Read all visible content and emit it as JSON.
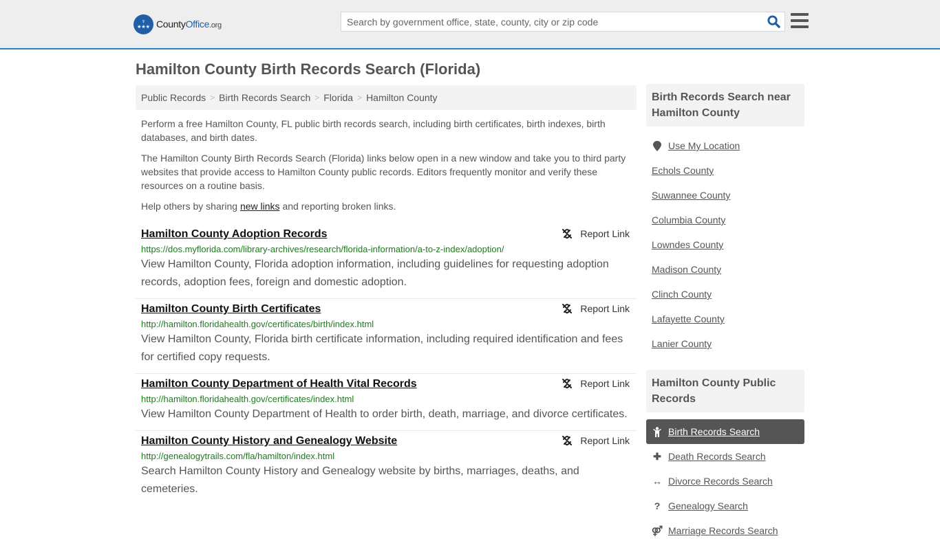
{
  "header": {
    "logo": {
      "part1": "County",
      "part2": "Office",
      "part3": ".org"
    },
    "search_placeholder": "Search by government office, state, county, city or zip code",
    "search_value": "",
    "accent_color": "#337ab7"
  },
  "page_title": "Hamilton County Birth Records Search (Florida)",
  "breadcrumb": [
    {
      "label": "Public Records"
    },
    {
      "label": "Birth Records Search"
    },
    {
      "label": "Florida"
    },
    {
      "label": "Hamilton County"
    }
  ],
  "intro": {
    "p1": "Perform a free Hamilton County, FL public birth records search, including birth certificates, birth indexes, birth databases, and birth dates.",
    "p2": "The Hamilton County Birth Records Search (Florida) links below open in a new window and take you to third party websites that provide access to Hamilton County public records. Editors frequently monitor and verify these resources on a routine basis.",
    "p3_before": "Help others by sharing ",
    "p3_link": "new links",
    "p3_after": " and reporting broken links."
  },
  "report_label": "Report Link",
  "results": [
    {
      "title": "Hamilton County Adoption Records",
      "url": "https://dos.myflorida.com/library-archives/research/florida-information/a-to-z-index/adoption/",
      "desc": "View Hamilton County, Florida adoption information, including guidelines for requesting adoption records, adoption fees, foreign and domestic adoption."
    },
    {
      "title": "Hamilton County Birth Certificates",
      "url": "http://hamilton.floridahealth.gov/certificates/birth/index.html",
      "desc": "View Hamilton County, Florida birth certificate information, including required identification and fees for certified copy requests."
    },
    {
      "title": "Hamilton County Department of Health Vital Records",
      "url": "http://hamilton.floridahealth.gov/certificates/index.html",
      "desc": "View Hamilton County Department of Health to order birth, death, marriage, and divorce certificates."
    },
    {
      "title": "Hamilton County History and Genealogy Website",
      "url": "http://genealogytrails.com/fla/hamilton/index.html",
      "desc": "Search Hamilton County History and Genealogy website by births, marriages, deaths, and cemeteries."
    }
  ],
  "sidebar": {
    "nearby_heading": "Birth Records Search near Hamilton County",
    "use_location": "Use My Location",
    "nearby": [
      "Echols County",
      "Suwannee County",
      "Columbia County",
      "Lowndes County",
      "Madison County",
      "Clinch County",
      "Lafayette County",
      "Lanier County"
    ],
    "public_heading": "Hamilton County Public Records",
    "public_records": [
      {
        "label": "Birth Records Search",
        "icon": "child-icon",
        "glyph": "♙",
        "active": true
      },
      {
        "label": "Death Records Search",
        "icon": "plus-icon",
        "glyph": "✚",
        "active": false
      },
      {
        "label": "Divorce Records Search",
        "icon": "arrows-horizontal-icon",
        "glyph": "↔",
        "active": false
      },
      {
        "label": "Genealogy Search",
        "icon": "question-icon",
        "glyph": "?",
        "active": false
      },
      {
        "label": "Marriage Records Search",
        "icon": "venus-mars-icon",
        "glyph": "⚤",
        "active": false
      }
    ]
  }
}
